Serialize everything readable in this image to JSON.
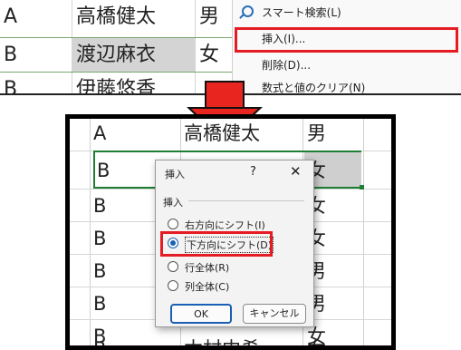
{
  "top_sheet": {
    "rows": [
      {
        "col_a": "A",
        "name": "高橋健太",
        "gender": "男"
      },
      {
        "col_a": "B",
        "name": "渡辺麻衣",
        "gender": "女"
      },
      {
        "col_a": "B",
        "name": "伊藤悠香",
        "gender": ""
      }
    ]
  },
  "context_menu": {
    "items": [
      {
        "label": "スマート検索(L)",
        "icon": "search-icon"
      },
      {
        "label": "挿入(I)...",
        "highlighted": true
      },
      {
        "label": "削除(D)..."
      },
      {
        "label": "数式と値のクリア(N)"
      }
    ]
  },
  "sheet": {
    "header_row": {
      "col_a": "A",
      "name": "高橋健太",
      "gender": "男"
    },
    "rows": [
      {
        "col_a": "B",
        "gender": "女"
      },
      {
        "col_a": "B",
        "gender": "女"
      },
      {
        "col_a": "B",
        "gender": "女"
      },
      {
        "col_a": "B",
        "gender": "男"
      },
      {
        "col_a": "B",
        "gender": "男"
      },
      {
        "col_a": "B",
        "gender": "女"
      },
      {
        "col_a": "B",
        "name": "木村中希",
        "gender": "女"
      }
    ]
  },
  "dialog": {
    "title": "挿入",
    "help_label": "?",
    "close_label": "✕",
    "group_label": "挿入",
    "options": [
      {
        "label": "右方向にシフト(I)",
        "selected": false
      },
      {
        "label": "下方向にシフト(D)",
        "selected": true
      },
      {
        "label": "行全体(R)",
        "selected": false
      },
      {
        "label": "列全体(C)",
        "selected": false
      }
    ],
    "ok_label": "OK",
    "cancel_label": "キャンセル"
  },
  "colors": {
    "highlight": "#e51c23",
    "arrow": "#e8261f",
    "accent": "#1a5fb4",
    "selection": "#cfcfcf"
  }
}
